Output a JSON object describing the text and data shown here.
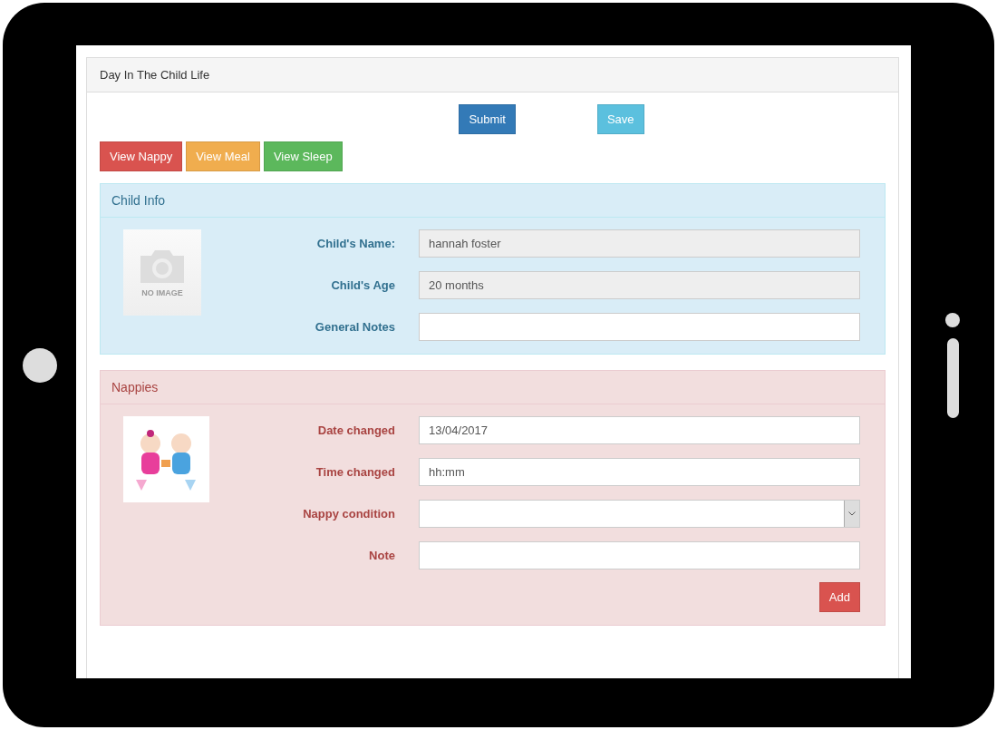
{
  "panel": {
    "title": "Day In The Child Life"
  },
  "actions": [
    {
      "label": "Submit",
      "kind": "primary"
    },
    {
      "label": "Save",
      "kind": "info"
    }
  ],
  "view_buttons": [
    {
      "label": "View Nappy",
      "kind": "danger"
    },
    {
      "label": "View Meal",
      "kind": "warning"
    },
    {
      "label": "View Sleep",
      "kind": "success"
    }
  ],
  "sections": [
    {
      "title": "Child Info",
      "kind": "info",
      "image": {
        "kind": "no_image",
        "caption": "NO IMAGE"
      },
      "fields": [
        {
          "label": "Child's Name:",
          "kind": "text",
          "value": "hannah foster",
          "readonly": true
        },
        {
          "label": "Child's Age",
          "kind": "text",
          "value": "20 months",
          "readonly": true
        },
        {
          "label": "General Notes",
          "kind": "text",
          "readonly": false
        }
      ]
    },
    {
      "title": "Nappies",
      "kind": "danger",
      "fields": [
        {
          "label": "Date changed",
          "kind": "text",
          "value": "13/04/2017",
          "readonly": false
        },
        {
          "label": "Time changed",
          "kind": "text",
          "value": "hh:mm",
          "readonly": false
        },
        {
          "label": "Nappy condition",
          "kind": "select"
        },
        {
          "label": "Note",
          "kind": "text",
          "readonly": false
        }
      ],
      "add_button": {
        "label": "Add"
      }
    }
  ]
}
